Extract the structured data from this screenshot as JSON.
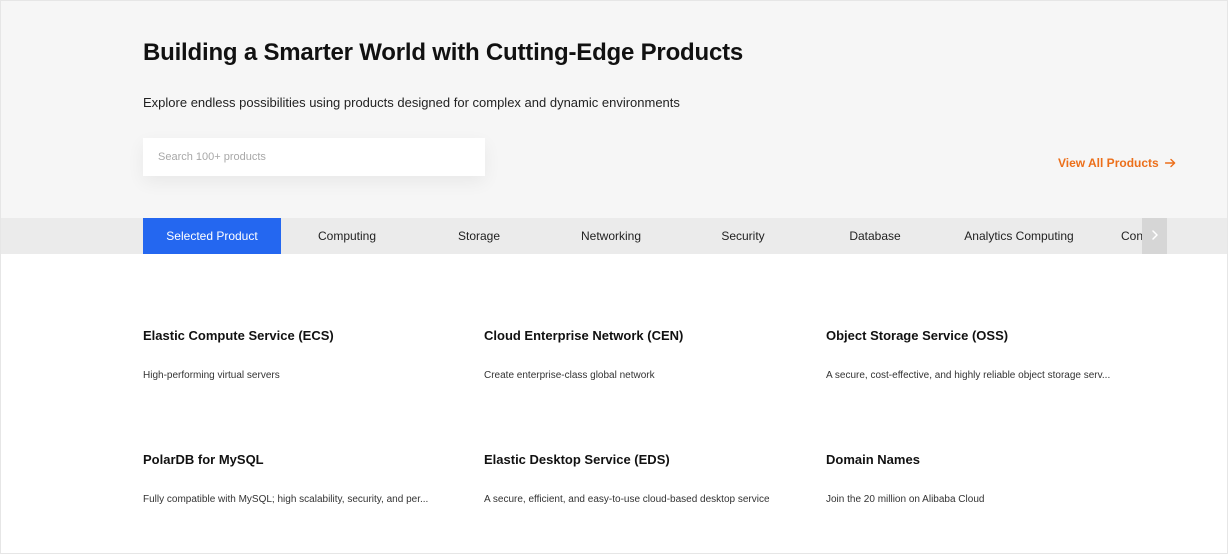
{
  "hero": {
    "title": "Building a Smarter World with Cutting-Edge Products",
    "subtitle": "Explore endless possibilities using products designed for complex and dynamic environments",
    "search_placeholder": "Search 100+ products",
    "view_all_label": "View All Products"
  },
  "tabs": [
    {
      "label": "Selected Product",
      "active": true
    },
    {
      "label": "Computing",
      "active": false
    },
    {
      "label": "Storage",
      "active": false
    },
    {
      "label": "Networking",
      "active": false
    },
    {
      "label": "Security",
      "active": false
    },
    {
      "label": "Database",
      "active": false
    },
    {
      "label": "Analytics Computing",
      "active": false
    },
    {
      "label": "Con",
      "active": false
    }
  ],
  "products": [
    {
      "title": "Elastic Compute Service (ECS)",
      "description": "High-performing virtual servers"
    },
    {
      "title": "Cloud Enterprise Network (CEN)",
      "description": "Create enterprise-class global network"
    },
    {
      "title": "Object Storage Service (OSS)",
      "description": "A secure, cost-effective, and highly reliable object storage serv..."
    },
    {
      "title": "PolarDB for MySQL",
      "description": "Fully compatible with MySQL; high scalability, security, and per..."
    },
    {
      "title": "Elastic Desktop Service (EDS)",
      "description": "A secure, efficient, and easy-to-use cloud-based desktop service"
    },
    {
      "title": "Domain Names",
      "description": "Join the 20 million on Alibaba Cloud"
    }
  ],
  "colors": {
    "accent_blue": "#2467f0",
    "link_orange": "#ec6f1a",
    "hero_bg": "#f6f6f6",
    "tabbar_bg": "#ebebeb"
  },
  "icons": {
    "view_all": "arrow-right-icon",
    "tab_scroll": "chevron-right-icon"
  }
}
